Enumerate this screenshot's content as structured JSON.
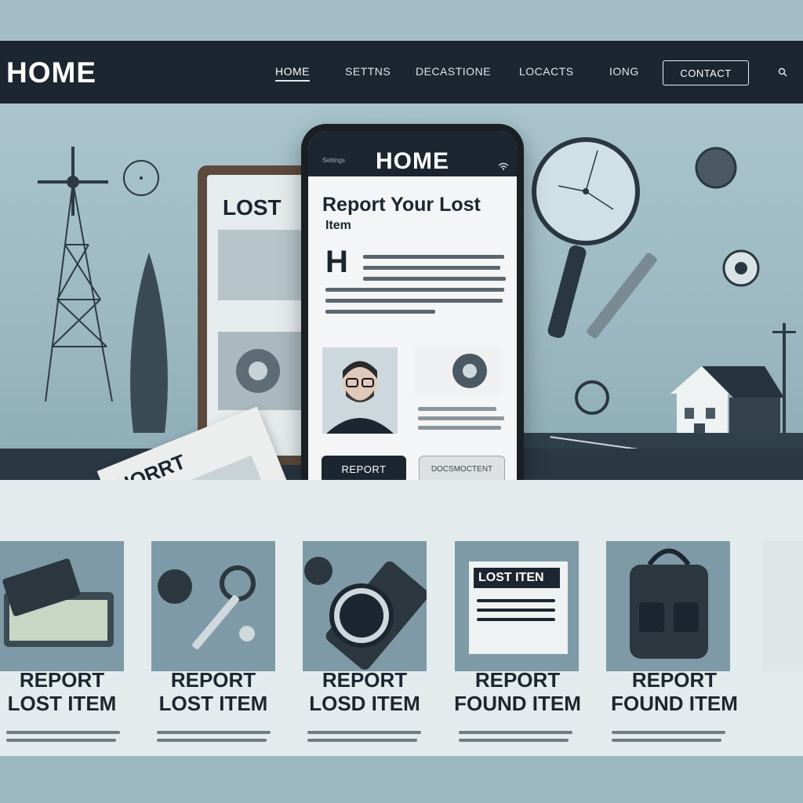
{
  "nav": {
    "brand": "HOME",
    "links": [
      "HOME",
      "SETTNS",
      "DECASTIONE",
      "LOCACTS",
      "IONG"
    ],
    "contact_label": "CONTACT"
  },
  "hero": {
    "tablet_title": "LOST",
    "paper_title": "HORRT"
  },
  "phone": {
    "status": "Settings",
    "title": "HOME",
    "heading_line1": "Report Your Lost",
    "heading_line2": "Item",
    "dropcap": "H",
    "report_button": "REPORT",
    "second_button": "DOCSMOCTENT"
  },
  "cards": [
    {
      "label_line1": "REPORT",
      "label_line2": "LOST ITEM",
      "icon": "wallet-icon"
    },
    {
      "label_line1": "REPORT",
      "label_line2": "LOST ITEM",
      "icon": "key-icon"
    },
    {
      "label_line1": "REPORT",
      "label_line2": "LOSD ITEM",
      "icon": "watch-icon"
    },
    {
      "label_line1": "REPORT",
      "label_line2": "FOUND ITEM",
      "icon": "lost-item-sheet-icon",
      "sheet_title": "LOST ITEN"
    },
    {
      "label_line1": "REPORT",
      "label_line2": "FOUND ITEM",
      "icon": "backpack-icon"
    }
  ],
  "colors": {
    "navbar": "#1c2630",
    "background": "#9db8c2",
    "accent_dark": "#1c2630"
  }
}
